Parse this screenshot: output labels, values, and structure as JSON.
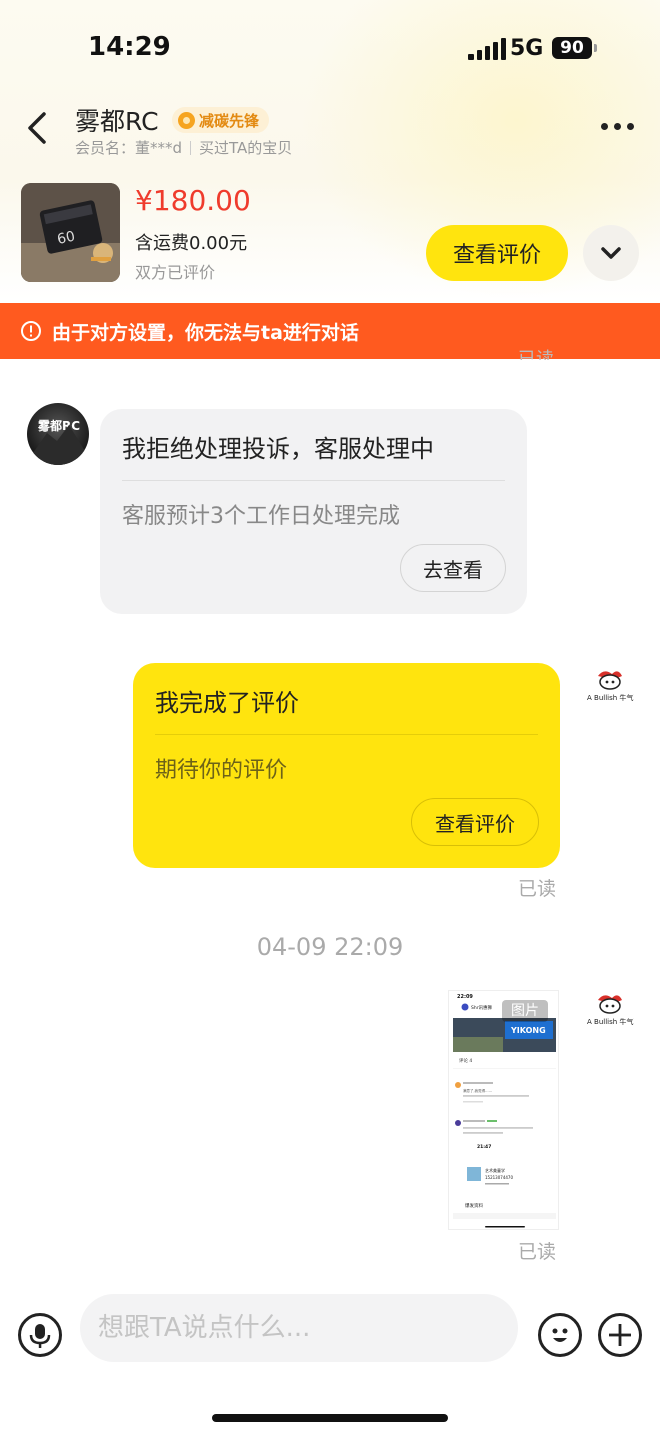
{
  "status_bar": {
    "time": "14:29",
    "network": "5G",
    "battery": "90"
  },
  "header": {
    "shop_name": "雾都RC",
    "badge": "减碳先锋",
    "member_label": "会员名：董***d",
    "purchase_note": "买过TA的宝贝",
    "icons": {
      "back": "chevron-left-icon",
      "more": "more-dots-icon"
    }
  },
  "product": {
    "price": "¥180.00",
    "shipping": "含运费0.00元",
    "review_status": "双方已评价",
    "view_review_label": "查看评价",
    "expand_icon": "chevron-down-icon"
  },
  "banner": {
    "text": "由于对方设置，你无法与ta进行对话",
    "icon": "alert-circle-icon",
    "color": "#ff5a1f"
  },
  "messages": [
    {
      "from": "seller",
      "avatar_text": "雾都RC",
      "title": "我拒绝处理投诉，客服处理中",
      "subtitle": "客服预计3个工作日处理完成",
      "action": "去查看"
    },
    {
      "from": "me",
      "avatar_text": "A Bullish 牛气冲天",
      "title": "我完成了评价",
      "subtitle": "期待你的评价",
      "action": "查看评价",
      "read_status": "已读"
    }
  ],
  "timestamp": "04-09 22:09",
  "image_message": {
    "tag": "图片",
    "read_status": "已读",
    "avatar_text": "A Bullish 牛气冲天",
    "screenshot": {
      "time": "22:09",
      "account": "Shr讯惠狮",
      "banner": "YIKONG",
      "tab": "评论 4",
      "post1": "满意了,我觉得……",
      "time2": "21:47",
      "contact_name": "艺术美童学",
      "contact_phone": "15213074470",
      "footer": "爆发资料"
    }
  },
  "peek_read": "已读",
  "input": {
    "placeholder": "想跟TA说点什么...",
    "value": ""
  },
  "toolbar": {
    "mic_icon": "microphone-icon",
    "emoji_icon": "emoji-smile-icon",
    "plus_icon": "plus-circle-icon"
  },
  "colors": {
    "accent_yellow": "#ffe40e",
    "price_red": "#ef3b2c",
    "badge_orange": "#e38a12"
  }
}
